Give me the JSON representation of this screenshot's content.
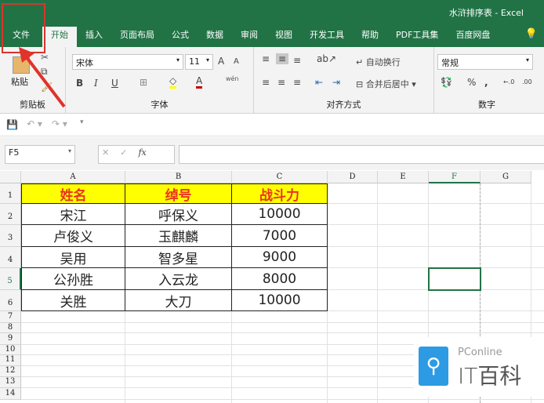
{
  "window_title": "水浒排序表 - Excel",
  "tabs": [
    "文件",
    "开始",
    "插入",
    "页面布局",
    "公式",
    "数据",
    "审阅",
    "视图",
    "开发工具",
    "帮助",
    "PDF工具集",
    "百度网盘"
  ],
  "ribbon": {
    "clipboard": {
      "paste": "粘贴",
      "label": "剪贴板"
    },
    "font": {
      "name": "宋体",
      "size": "11",
      "label": "字体",
      "bold": "B",
      "italic": "I",
      "underline": "U",
      "grow": "A",
      "shrink": "A",
      "color": "A",
      "phonetic": "wén"
    },
    "alignment": {
      "wrap": "自动换行",
      "merge": "合并后居中",
      "label": "对齐方式"
    },
    "number": {
      "format": "常规",
      "percent": "%",
      "comma": ",",
      "label": "数字",
      "inc": "←.0",
      "dec": ".00"
    }
  },
  "formula_bar": {
    "name_box": "F5",
    "fx": "fx",
    "value": ""
  },
  "columns": [
    "A",
    "B",
    "C",
    "D",
    "E",
    "F",
    "G"
  ],
  "rows": [
    "1",
    "2",
    "3",
    "4",
    "5",
    "6",
    "7",
    "8",
    "9",
    "10",
    "11",
    "12",
    "13",
    "14"
  ],
  "table": {
    "headers": [
      "姓名",
      "绰号",
      "战斗力"
    ],
    "rows": [
      [
        "宋江",
        "呼保义",
        "10000"
      ],
      [
        "卢俊义",
        "玉麒麟",
        "7000"
      ],
      [
        "吴用",
        "智多星",
        "9000"
      ],
      [
        "公孙胜",
        "入云龙",
        "8000"
      ],
      [
        "关胜",
        "大刀",
        "10000"
      ]
    ]
  },
  "watermark": {
    "top": "PConline",
    "bottom": "IT百科"
  }
}
